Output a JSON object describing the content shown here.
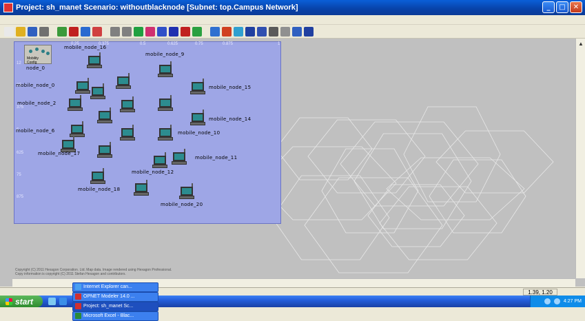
{
  "window": {
    "title": "Project: sh_manet Scenario: withoutblacknode  [Subnet: top.Campus Network]"
  },
  "toolbar": {
    "icons": [
      {
        "name": "new-icon",
        "color": "#e9e9e9"
      },
      {
        "name": "open-icon",
        "color": "#e0b020"
      },
      {
        "name": "save-icon",
        "color": "#3060c0"
      },
      {
        "name": "print-icon",
        "color": "#707070"
      },
      {
        "name": "object-palette-icon",
        "color": "#3a9a3a"
      },
      {
        "name": "check-links-icon",
        "color": "#c02020"
      },
      {
        "name": "fail-node-icon",
        "color": "#2a6ad0"
      },
      {
        "name": "recover-node-icon",
        "color": "#d04040"
      },
      {
        "name": "zoom-in-icon",
        "color": "#808080"
      },
      {
        "name": "zoom-out-icon",
        "color": "#808080"
      },
      {
        "name": "configure-link-icon",
        "color": "#20a040"
      },
      {
        "name": "configure-node-icon",
        "color": "#d03070"
      },
      {
        "name": "configure-traffic-icon",
        "color": "#3050c8"
      },
      {
        "name": "configure-discrete-event-icon",
        "color": "#2030b0"
      },
      {
        "name": "view-results-icon",
        "color": "#c02020"
      },
      {
        "name": "hide-graphs-icon",
        "color": "#2aa040"
      },
      {
        "name": "web-report-icon",
        "color": "#3070d0"
      },
      {
        "name": "favorite-icon",
        "color": "#d04020"
      },
      {
        "name": "animation-icon",
        "color": "#30a0d0"
      },
      {
        "name": "flow-analysis-icon",
        "color": "#2040a0"
      },
      {
        "name": "topology-icon",
        "color": "#3050b0"
      },
      {
        "name": "report-icon",
        "color": "#5a5a5a"
      },
      {
        "name": "cell-icon",
        "color": "#909090"
      },
      {
        "name": "table-icon",
        "color": "#3060c0"
      },
      {
        "name": "grid-icon",
        "color": "#2040a0"
      }
    ]
  },
  "subnet": {
    "rulers": [
      "0.25",
      "0.375",
      "0.5",
      "0.625",
      "0.75",
      "0.875",
      "1",
      "12",
      "25",
      "375",
      "5",
      "625",
      "75",
      "875"
    ],
    "mobility_config": {
      "label_1": "Mobility",
      "label_2": "Config",
      "node_label": "node_0"
    },
    "nodes": [
      {
        "label": "mobile_node_16"
      },
      {
        "label": "mobile_node_9"
      },
      {
        "label": "mobile_node_0"
      },
      {
        "label": "mobile_node_15"
      },
      {
        "label": "mobile_node_2"
      },
      {
        "label": "mobile_node_14"
      },
      {
        "label": "mobile_node_6"
      },
      {
        "label": "mobile_node_10"
      },
      {
        "label": "mobile_node_17"
      },
      {
        "label": "mobile_node_11"
      },
      {
        "label": "mobile_node_12"
      },
      {
        "label": "mobile_node_18"
      },
      {
        "label": "mobile_node_20"
      }
    ]
  },
  "copyright": {
    "line1": "Copyright (C) 2011 Hexagon Corporation. Ltd. Map data. Image rendered using Hexagon Professional.",
    "line2": "Copy information is copyright (C) 2011 Stefan Hexagon and contributors."
  },
  "status": {
    "coords": "1.39, 1.20"
  },
  "taskbar": {
    "start": "start",
    "tasks": [
      {
        "label": "Internet Explorer can...",
        "color": "#4aa0f0"
      },
      {
        "label": "OPNET Modeler 14.0 ...",
        "color": "#d03030"
      },
      {
        "label": "Project: sh_manet Sc...",
        "color": "#d03030"
      },
      {
        "label": "Microsoft Excel - Blac...",
        "color": "#2a8a3a"
      }
    ],
    "clock": "4:27 PM"
  }
}
